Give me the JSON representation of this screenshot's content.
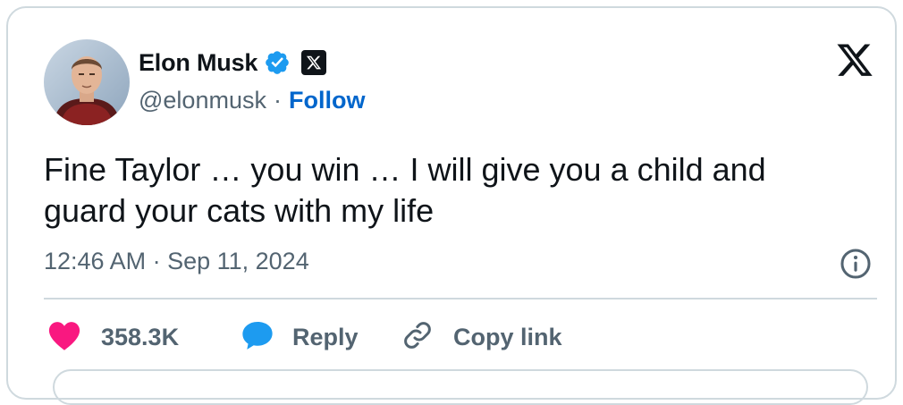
{
  "author": {
    "name": "Elon Musk",
    "handle": "@elonmusk",
    "separator": "·",
    "follow_label": "Follow"
  },
  "tweet": {
    "text": "Fine Taylor … you win … I will give you a child and guard your cats with my life",
    "timestamp": "12:46 AM · Sep 11, 2024"
  },
  "actions": {
    "like_count": "358.3K",
    "reply_label": "Reply",
    "copy_link_label": "Copy link"
  },
  "colors": {
    "verified_blue": "#1d9bf0",
    "follow_blue": "#0066cc",
    "like_pink": "#f91880",
    "reply_blue": "#1d9bf0",
    "secondary_text": "#536471",
    "border": "#cfd9de"
  },
  "icons": {
    "verified": "verified-badge-icon",
    "x_affiliation": "x-affiliation-badge-icon",
    "x_logo": "x-logo-icon",
    "info": "info-icon",
    "like": "heart-icon",
    "reply": "speech-bubble-icon",
    "copy_link": "link-icon"
  }
}
